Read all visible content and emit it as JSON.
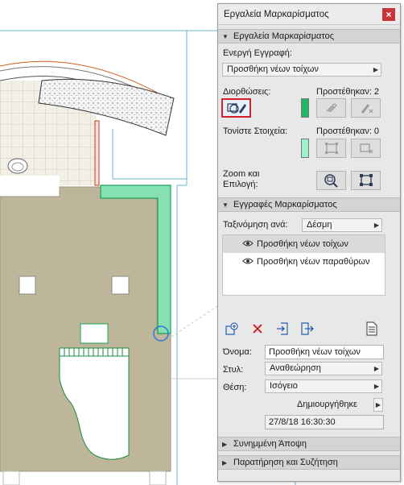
{
  "palette": {
    "title": "Εργαλεία Μαρκαρίσματος",
    "close_glyph": "×",
    "section1": {
      "header": "Εργαλεία Μαρκαρίσματος",
      "active_entry_label": "Ενεργή Εγγραφή:",
      "active_entry_value": "Προσθήκη νέων τοίχων",
      "corrections_label": "Διορθώσεις:",
      "added_label": "Προστέθηκαν: 2",
      "highlight_label": "Τονίστε Στοιχεία:",
      "added_label_2": "Προστέθηκαν: 0",
      "zoom_label_line1": "Zoom και",
      "zoom_label_line2": "Επιλογή:",
      "correction_color": "#1db861",
      "highlight_color": "#9ff2c8"
    },
    "section2": {
      "header": "Εγγραφές Μαρκαρίσματος",
      "sort_label": "Ταξινόμηση ανά:",
      "sort_value": "Δέσμη",
      "entries": [
        {
          "label": "Προσθήκη νέων τοίχων"
        },
        {
          "label": "Προσθήκη νέων παραθύρων"
        }
      ],
      "name_label": "Όνομα:",
      "name_value": "Προσθήκη νέων τοίχων",
      "style_label": "Στυλ:",
      "style_value": "Αναθεώρηση",
      "position_label": "Θέση:",
      "position_value": "Ισόγειο",
      "created_label": "Δημιουργήθηκε",
      "created_value": "27/8/18 16:30:30"
    },
    "section3": {
      "header": "Συνημμένη Άποψη"
    },
    "section4": {
      "header": "Παρατήρηση και Συζήτηση"
    }
  },
  "icons": {
    "tri_down": "▼",
    "tri_right": "▶",
    "dropdown_arrow": "▶"
  }
}
